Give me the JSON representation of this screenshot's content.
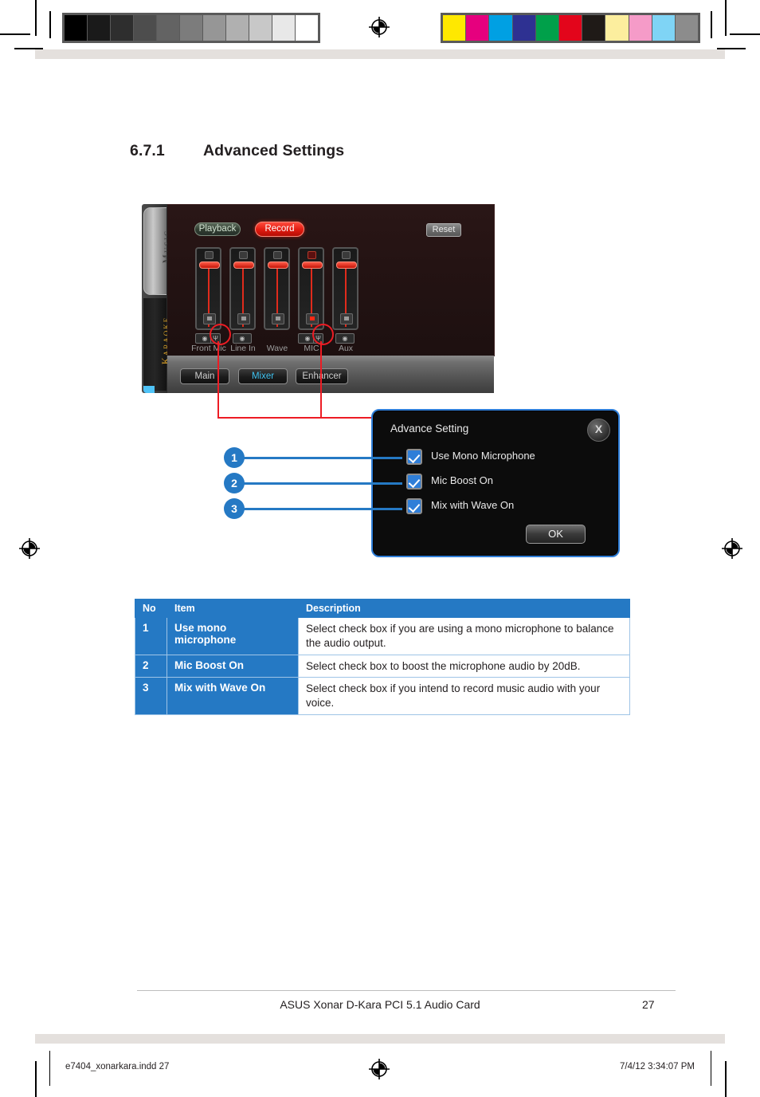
{
  "page": {
    "heading_number": "6.7.1",
    "heading_title": "Advanced Settings",
    "footer_title": "ASUS Xonar D-Kara PCI 5.1 Audio Card",
    "footer_page": "27",
    "imprint_left": "e7404_xonarkara.indd   27",
    "imprint_right": "7/4/12   3:34:07 PM"
  },
  "calibration": {
    "grayscale": [
      "#000000",
      "#1a1a1a",
      "#2e2e2e",
      "#4d4d4d",
      "#636363",
      "#7c7c7c",
      "#969696",
      "#b0b0b0",
      "#c8c8c8",
      "#e8e8e8",
      "#ffffff"
    ],
    "colors": [
      "#ffe800",
      "#e6007e",
      "#00a0e3",
      "#2e3192",
      "#00a04a",
      "#e3051b",
      "#1f1a17",
      "#fcee9e",
      "#f59bc8",
      "#7fd4f5",
      "#8c8c8c"
    ]
  },
  "app": {
    "side_tabs": [
      {
        "label": "Music",
        "state": "inactive"
      },
      {
        "label": "Karaoke",
        "state": "active"
      }
    ],
    "toolbar": {
      "playback_label": "Playback",
      "record_label": "Record",
      "reset_label": "Reset",
      "active": "Record"
    },
    "mixer_channels": [
      {
        "label": "Front Mic",
        "muted": false,
        "level": 88,
        "buttons": [
          "mono-toggle",
          "mic-boost"
        ]
      },
      {
        "label": "Line In",
        "muted": false,
        "level": 88,
        "buttons": [
          "mono-toggle"
        ]
      },
      {
        "label": "Wave",
        "muted": false,
        "level": 84,
        "buttons": []
      },
      {
        "label": "MIC",
        "muted": true,
        "level": 88,
        "buttons": [
          "mono-toggle",
          "mic-boost"
        ]
      },
      {
        "label": "Aux",
        "muted": false,
        "level": 88,
        "buttons": [
          "mono-toggle"
        ]
      }
    ],
    "bottom_tabs": [
      {
        "label": "Main",
        "active": false
      },
      {
        "label": "Mixer",
        "active": true
      },
      {
        "label": "Enhancer",
        "active": false
      }
    ]
  },
  "dialog": {
    "title": "Advance Setting",
    "close_label": "X",
    "ok_label": "OK",
    "options": [
      {
        "label": "Use Mono Microphone",
        "checked": true
      },
      {
        "label": "Mic Boost On",
        "checked": true
      },
      {
        "label": "Mix with Wave On",
        "checked": true
      }
    ]
  },
  "callouts": [
    {
      "number": "1"
    },
    {
      "number": "2"
    },
    {
      "number": "3"
    }
  ],
  "table": {
    "headers": [
      "No",
      "Item",
      "Description"
    ],
    "rows": [
      {
        "no": "1",
        "item": "Use mono microphone",
        "desc": "Select check box if you are using a mono microphone to balance the audio output."
      },
      {
        "no": "2",
        "item": "Mic Boost On",
        "desc": "Select check box to boost the microphone audio by 20dB."
      },
      {
        "no": "3",
        "item": "Mix with Wave On",
        "desc": "Select check box if you intend to record music audio with your voice."
      }
    ]
  },
  "colors": {
    "accent_blue": "#2579c4",
    "callout_red": "#ed1c24",
    "tab_cyan": "#3fc2f0",
    "karaoke_gold": "#d79f28"
  }
}
